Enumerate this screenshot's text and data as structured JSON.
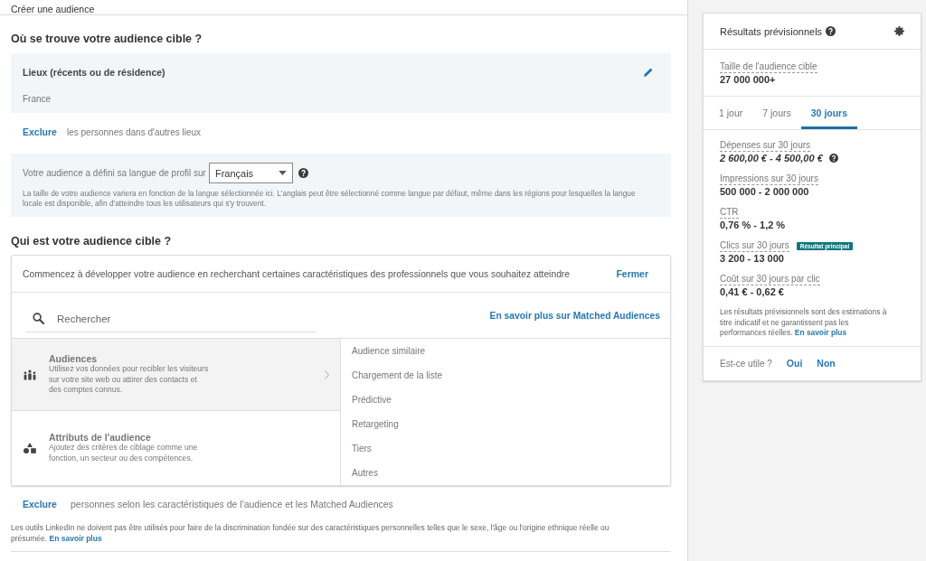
{
  "header": {
    "title": "Créer une audience"
  },
  "location_section": {
    "heading": "Où se trouve votre audience cible ?",
    "locations": {
      "label": "Lieux (récents ou de résidence)",
      "values": [
        "France"
      ]
    },
    "exclude": {
      "link": "Exclure",
      "text": "les personnes dans d'autres lieux"
    }
  },
  "language": {
    "label": "Votre audience a défini sa langue de profil sur",
    "value": "Français",
    "note": "La taille de votre audience variera en fonction de la langue sélectionnée ici. L'anglais peut être sélectionné comme langue par défaut, même dans les régions pour lesquelles la langue locale est disponible, afin d'atteindre tous les utilisateurs qui s'y trouvent."
  },
  "audience_section": {
    "heading": "Qui est votre audience cible ?",
    "intro": "Commencez à développer votre audience en recherchant certaines caractéristiques des professionnels que vous souhaitez atteindre",
    "close_link": "Fermer",
    "search": {
      "placeholder": "Rechercher"
    },
    "learn_more_link": "En savoir plus sur Matched Audiences",
    "categories": [
      {
        "title": "Audiences",
        "description": "Utilisez vos données pour recibler les visiteurs sur votre site web ou attirer des contacts et des comptes connus.",
        "selected": true
      },
      {
        "title": "Attributs de l'audience",
        "description": "Ajoutez des critères de ciblage comme une fonction, un secteur ou des compétences.",
        "selected": false
      }
    ],
    "subcategories": [
      "Audience similaire",
      "Chargement de la liste",
      "Prédictive",
      "Retargeting",
      "Tiers",
      "Autres"
    ],
    "exclude": {
      "link": "Exclure",
      "text": "personnes selon les caractéristiques de l'audience et les Matched Audiences"
    }
  },
  "disclaimer": {
    "text": "Les outils LinkedIn ne doivent pas être utilisés pour faire de la discrimination fondée sur des caractéristiques personnelles telles que le sexe, l'âge ou l'origine ethnique réelle ou présumée.",
    "link": "En savoir plus"
  },
  "forecast": {
    "title": "Résultats prévisionnels",
    "audience_size": {
      "label": "Taille de l'audience cible",
      "value": "27 000 000+"
    },
    "tabs": [
      {
        "label": "1 jour",
        "selected": false
      },
      {
        "label": "7 jours",
        "selected": false
      },
      {
        "label": "30 jours",
        "selected": true
      }
    ],
    "metrics": [
      {
        "label": "Dépenses sur 30 jours",
        "value": "2 600,00 € - 4 500,00 €",
        "kind": "budget"
      },
      {
        "label": "Impressions sur 30 jours",
        "value": "500 000 - 2 000 000",
        "kind": "result"
      },
      {
        "label": "CTR",
        "value": "0,76 % - 1,2 %",
        "kind": "result"
      },
      {
        "label": "Clics sur 30 jours",
        "value": "3 200 - 13 000",
        "kind": "result",
        "badge": "Résultat principal"
      },
      {
        "label": "Coût sur 30 jours par clic",
        "value": "0,41 € - 0,62 €",
        "kind": "result"
      }
    ],
    "note": {
      "text": "Les résultats prévisionnels sont des estimations à titre indicatif et ne garantissent pas les performances réelles.",
      "link": "En savoir plus"
    },
    "feedback": {
      "question": "Est-ce utile ?",
      "options": [
        "Oui",
        "Non"
      ]
    }
  }
}
